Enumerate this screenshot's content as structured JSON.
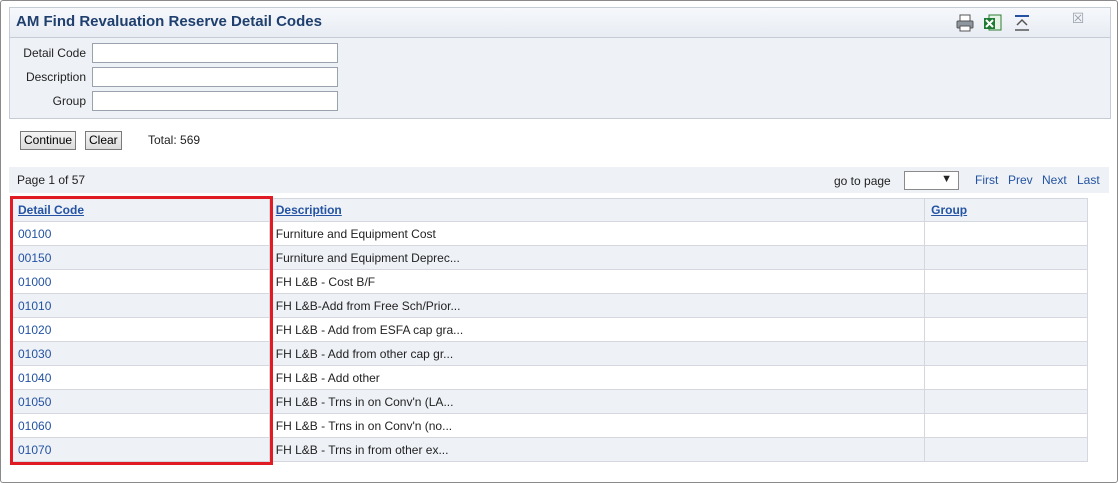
{
  "window": {
    "title": "AM Find Revaluation Reserve Detail Codes"
  },
  "toolbar": {
    "icons": [
      "print-icon",
      "excel-export-icon",
      "collapse-icon",
      "close-icon"
    ]
  },
  "search": {
    "fields": [
      {
        "label": "Detail Code",
        "value": ""
      },
      {
        "label": "Description",
        "value": ""
      },
      {
        "label": "Group",
        "value": ""
      }
    ],
    "continue_label": "Continue",
    "clear_label": "Clear",
    "total": "Total: 569"
  },
  "pager": {
    "page_info": "Page 1 of 57",
    "goto_label": "go to page",
    "goto_value": "",
    "first": "First",
    "prev": "Prev",
    "next": "Next",
    "last": "Last"
  },
  "table": {
    "headers": [
      "Detail Code",
      "Description",
      "Group"
    ],
    "rows": [
      {
        "code": "00100",
        "description": "Furniture and Equipment Cost",
        "group": ""
      },
      {
        "code": "00150",
        "description": "Furniture and Equipment Deprec...",
        "group": ""
      },
      {
        "code": "01000",
        "description": "FH L&B - Cost B/F",
        "group": ""
      },
      {
        "code": "01010",
        "description": "FH L&B-Add from Free Sch/Prior...",
        "group": ""
      },
      {
        "code": "01020",
        "description": "FH L&B - Add from ESFA cap gra...",
        "group": ""
      },
      {
        "code": "01030",
        "description": "FH L&B - Add from other cap gr...",
        "group": ""
      },
      {
        "code": "01040",
        "description": "FH L&B - Add other",
        "group": ""
      },
      {
        "code": "01050",
        "description": "FH L&B - Trns in on Conv'n (LA...",
        "group": ""
      },
      {
        "code": "01060",
        "description": "FH L&B - Trns in on Conv'n (no...",
        "group": ""
      },
      {
        "code": "01070",
        "description": "FH L&B - Trns in from other ex...",
        "group": ""
      }
    ]
  },
  "colors": {
    "accent": "#2353a2",
    "highlight_box": "#e01b24",
    "panel": "#eef1f6"
  }
}
